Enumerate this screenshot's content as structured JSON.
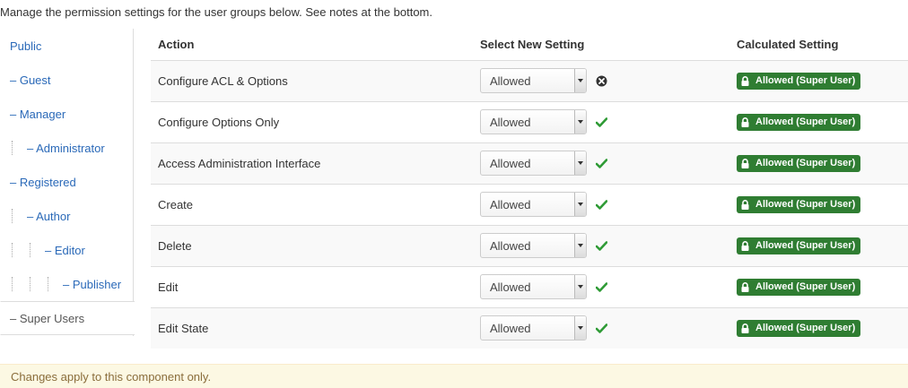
{
  "intro_text": "Manage the permission settings for the user groups below. See notes at the bottom.",
  "sidebar": {
    "items": [
      {
        "label": "Public",
        "level": 0,
        "prefix": ""
      },
      {
        "label": "– Guest",
        "level": 0,
        "prefix": "–"
      },
      {
        "label": "– Manager",
        "level": 0,
        "prefix": "–"
      },
      {
        "label": "– Administrator",
        "level": 1,
        "prefix": "–"
      },
      {
        "label": "– Registered",
        "level": 0,
        "prefix": "–"
      },
      {
        "label": "– Author",
        "level": 1,
        "prefix": "–"
      },
      {
        "label": "– Editor",
        "level": 2,
        "prefix": "–"
      },
      {
        "label": "– Publisher",
        "level": 3,
        "prefix": "–"
      },
      {
        "label": "– Super Users",
        "level": 0,
        "prefix": "–",
        "active": true
      }
    ]
  },
  "table": {
    "headers": {
      "action": "Action",
      "select": "Select New Setting",
      "calculated": "Calculated Setting"
    },
    "rows": [
      {
        "action": "Configure ACL & Options",
        "setting": "Allowed",
        "status": "error",
        "calculated": "Allowed (Super User)"
      },
      {
        "action": "Configure Options Only",
        "setting": "Allowed",
        "status": "ok",
        "calculated": "Allowed (Super User)"
      },
      {
        "action": "Access Administration Interface",
        "setting": "Allowed",
        "status": "ok",
        "calculated": "Allowed (Super User)"
      },
      {
        "action": "Create",
        "setting": "Allowed",
        "status": "ok",
        "calculated": "Allowed (Super User)"
      },
      {
        "action": "Delete",
        "setting": "Allowed",
        "status": "ok",
        "calculated": "Allowed (Super User)"
      },
      {
        "action": "Edit",
        "setting": "Allowed",
        "status": "ok",
        "calculated": "Allowed (Super User)"
      },
      {
        "action": "Edit State",
        "setting": "Allowed",
        "status": "ok",
        "calculated": "Allowed (Super User)"
      }
    ]
  },
  "icons": {
    "ok": "check-icon",
    "error": "error-circle-icon",
    "badge": "lock-icon"
  },
  "colors": {
    "link": "#2a69b8",
    "ok_green": "#2f9b36",
    "badge_green": "#2f7d32",
    "notice_bg": "#fcf8e3",
    "notice_text": "#8a6d3b"
  },
  "notice_text": "Changes apply to this component only."
}
